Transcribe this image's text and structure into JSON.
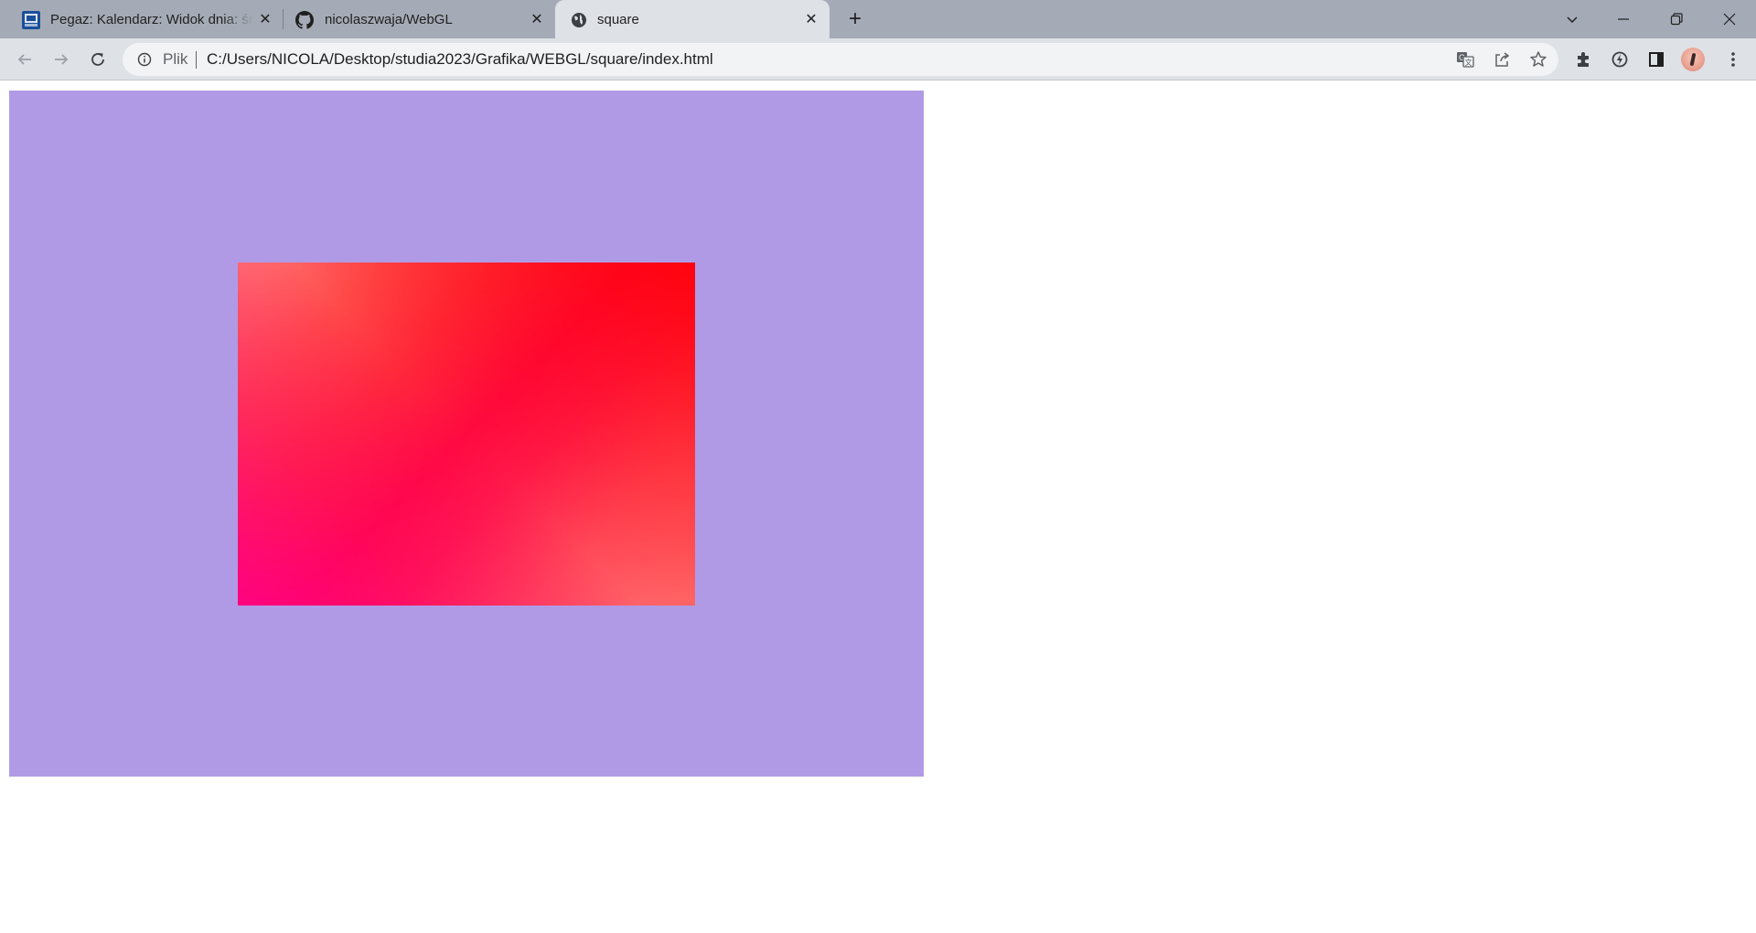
{
  "browser": {
    "tabs": [
      {
        "title": "Pegaz: Kalendarz: Widok dnia: śro",
        "favicon": "pegaz-logo-icon",
        "active": false
      },
      {
        "title": "nicolaszwaja/WebGL",
        "favicon": "github-icon",
        "active": false
      },
      {
        "title": "square",
        "favicon": "globe-icon",
        "active": true
      }
    ],
    "address_bar": {
      "scheme_chip": "Plik",
      "url": "C:/Users/NICOLA/Desktop/studia2023/Grafika/WEBGL/square/index.html"
    }
  },
  "page": {
    "canvas_background": "#b19ae5",
    "square_colors": [
      "#ff0a90",
      "#ff0000",
      "#ff7373"
    ]
  }
}
